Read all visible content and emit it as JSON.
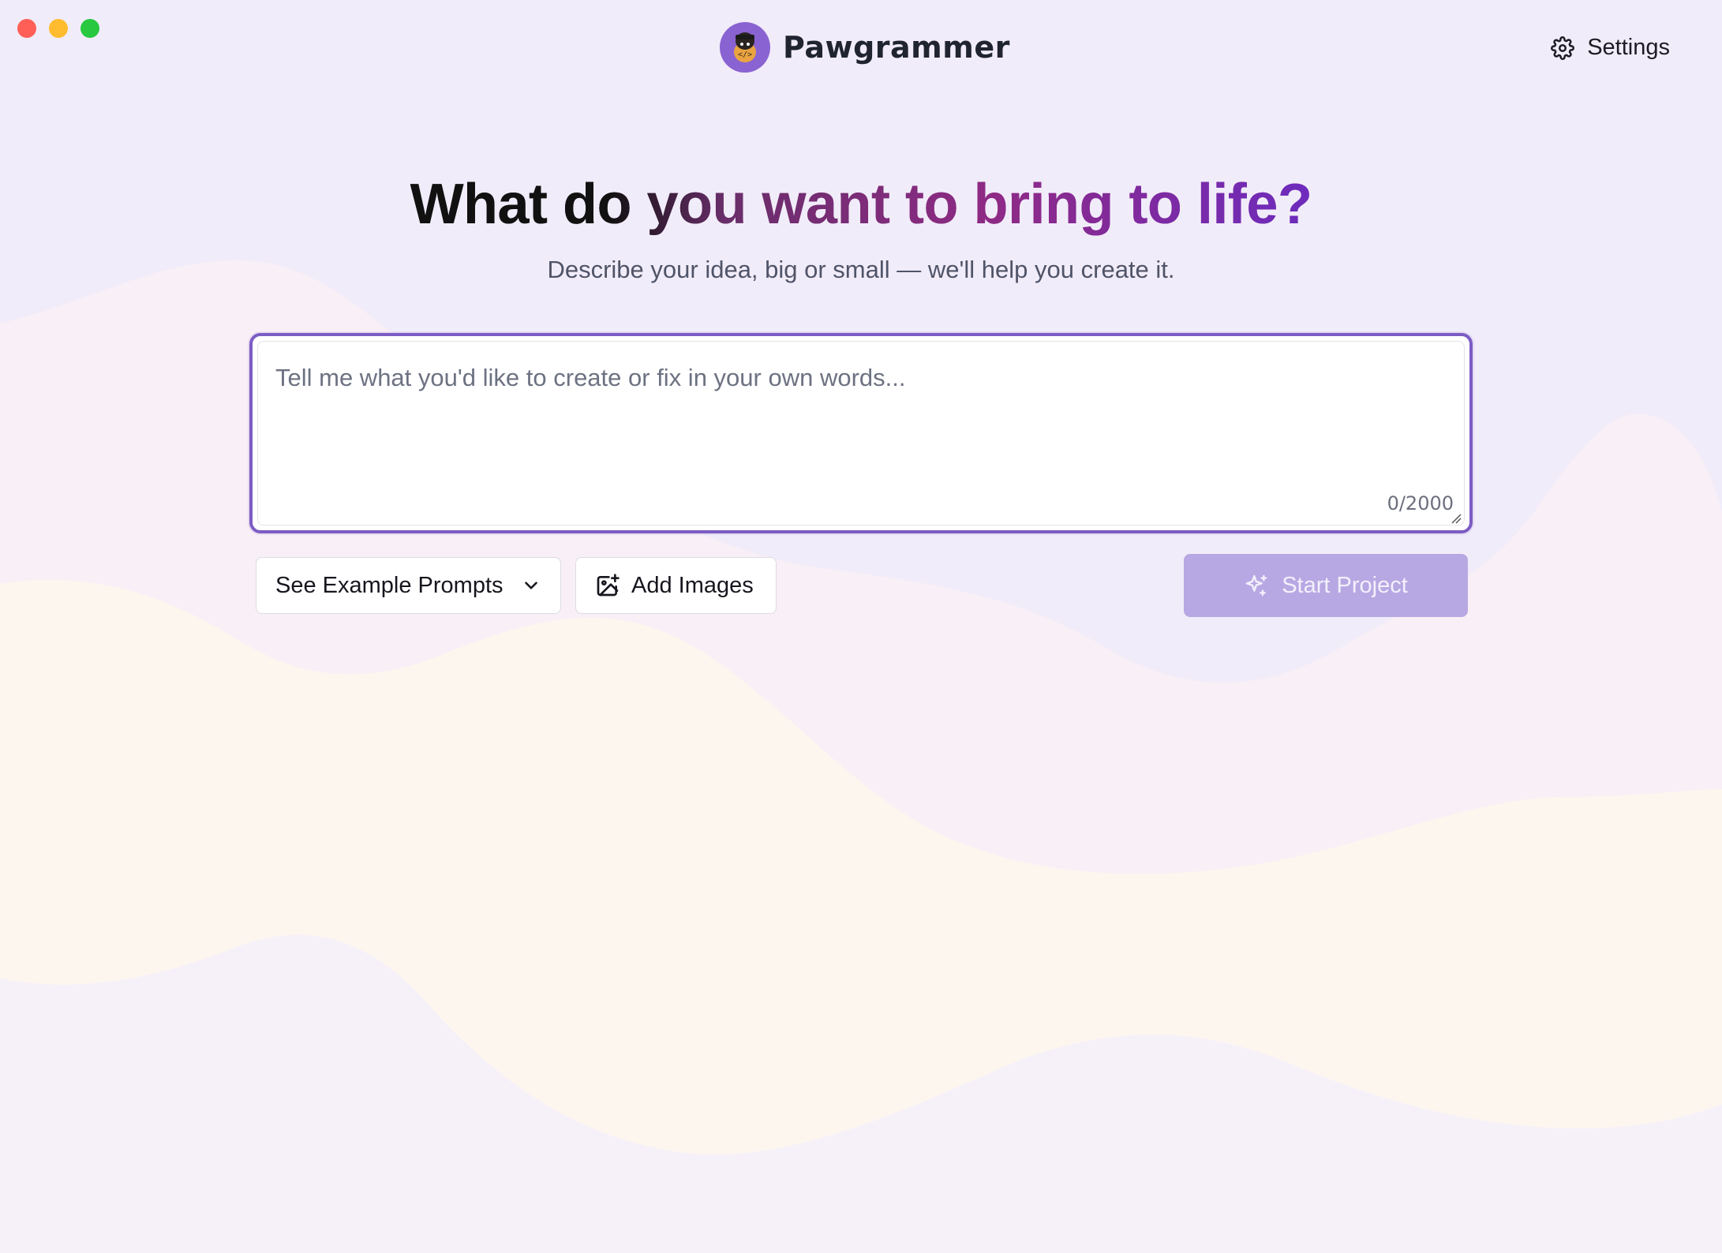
{
  "window": {
    "traffic_lights": [
      "close",
      "minimize",
      "maximize"
    ]
  },
  "brand": {
    "name": "Pawgrammer",
    "logo_icon": "dog-coder-logo",
    "logo_color": "#8a63d2"
  },
  "settings": {
    "label": "Settings",
    "icon": "gear-icon"
  },
  "hero": {
    "title": "What do you want to bring to life?",
    "subtitle": "Describe your idea, big or small — we'll help you create it."
  },
  "prompt": {
    "placeholder": "Tell me what you'd like to create or fix in your own words...",
    "value": "",
    "counter": "0/2000",
    "accent": "#7c5cc4"
  },
  "actions": {
    "examples_label": "See Example Prompts",
    "examples_icon": "chevron-down-icon",
    "images_label": "Add Images",
    "images_icon": "add-image-icon",
    "start_label": "Start Project",
    "start_icon": "sparkle-icon",
    "start_color": "#b7a8e3"
  }
}
